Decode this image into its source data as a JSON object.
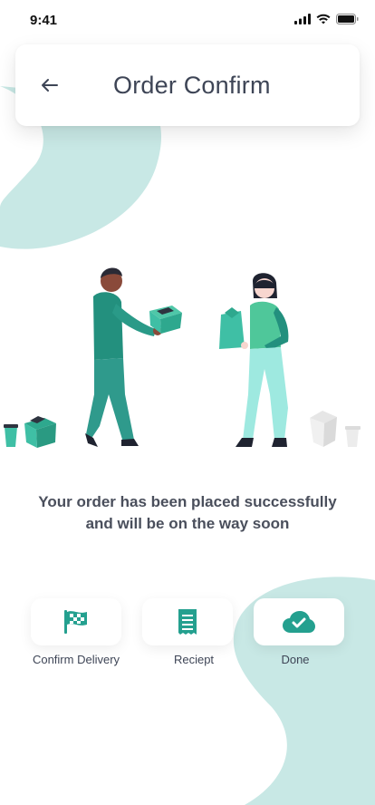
{
  "status_bar": {
    "time": "9:41"
  },
  "header": {
    "title": "Order Confirm"
  },
  "message": {
    "line1": "Your order has been placed successfully",
    "line2": "and will be on the way soon"
  },
  "actions": [
    {
      "label": "Confirm Delivery",
      "icon": "checkered-flag-icon"
    },
    {
      "label": "Reciept",
      "icon": "receipt-icon"
    },
    {
      "label": "Done",
      "icon": "cloud-check-icon"
    }
  ],
  "colors": {
    "accent": "#24a08f",
    "teal_light": "#c8e8e5",
    "text": "#3e4556"
  }
}
